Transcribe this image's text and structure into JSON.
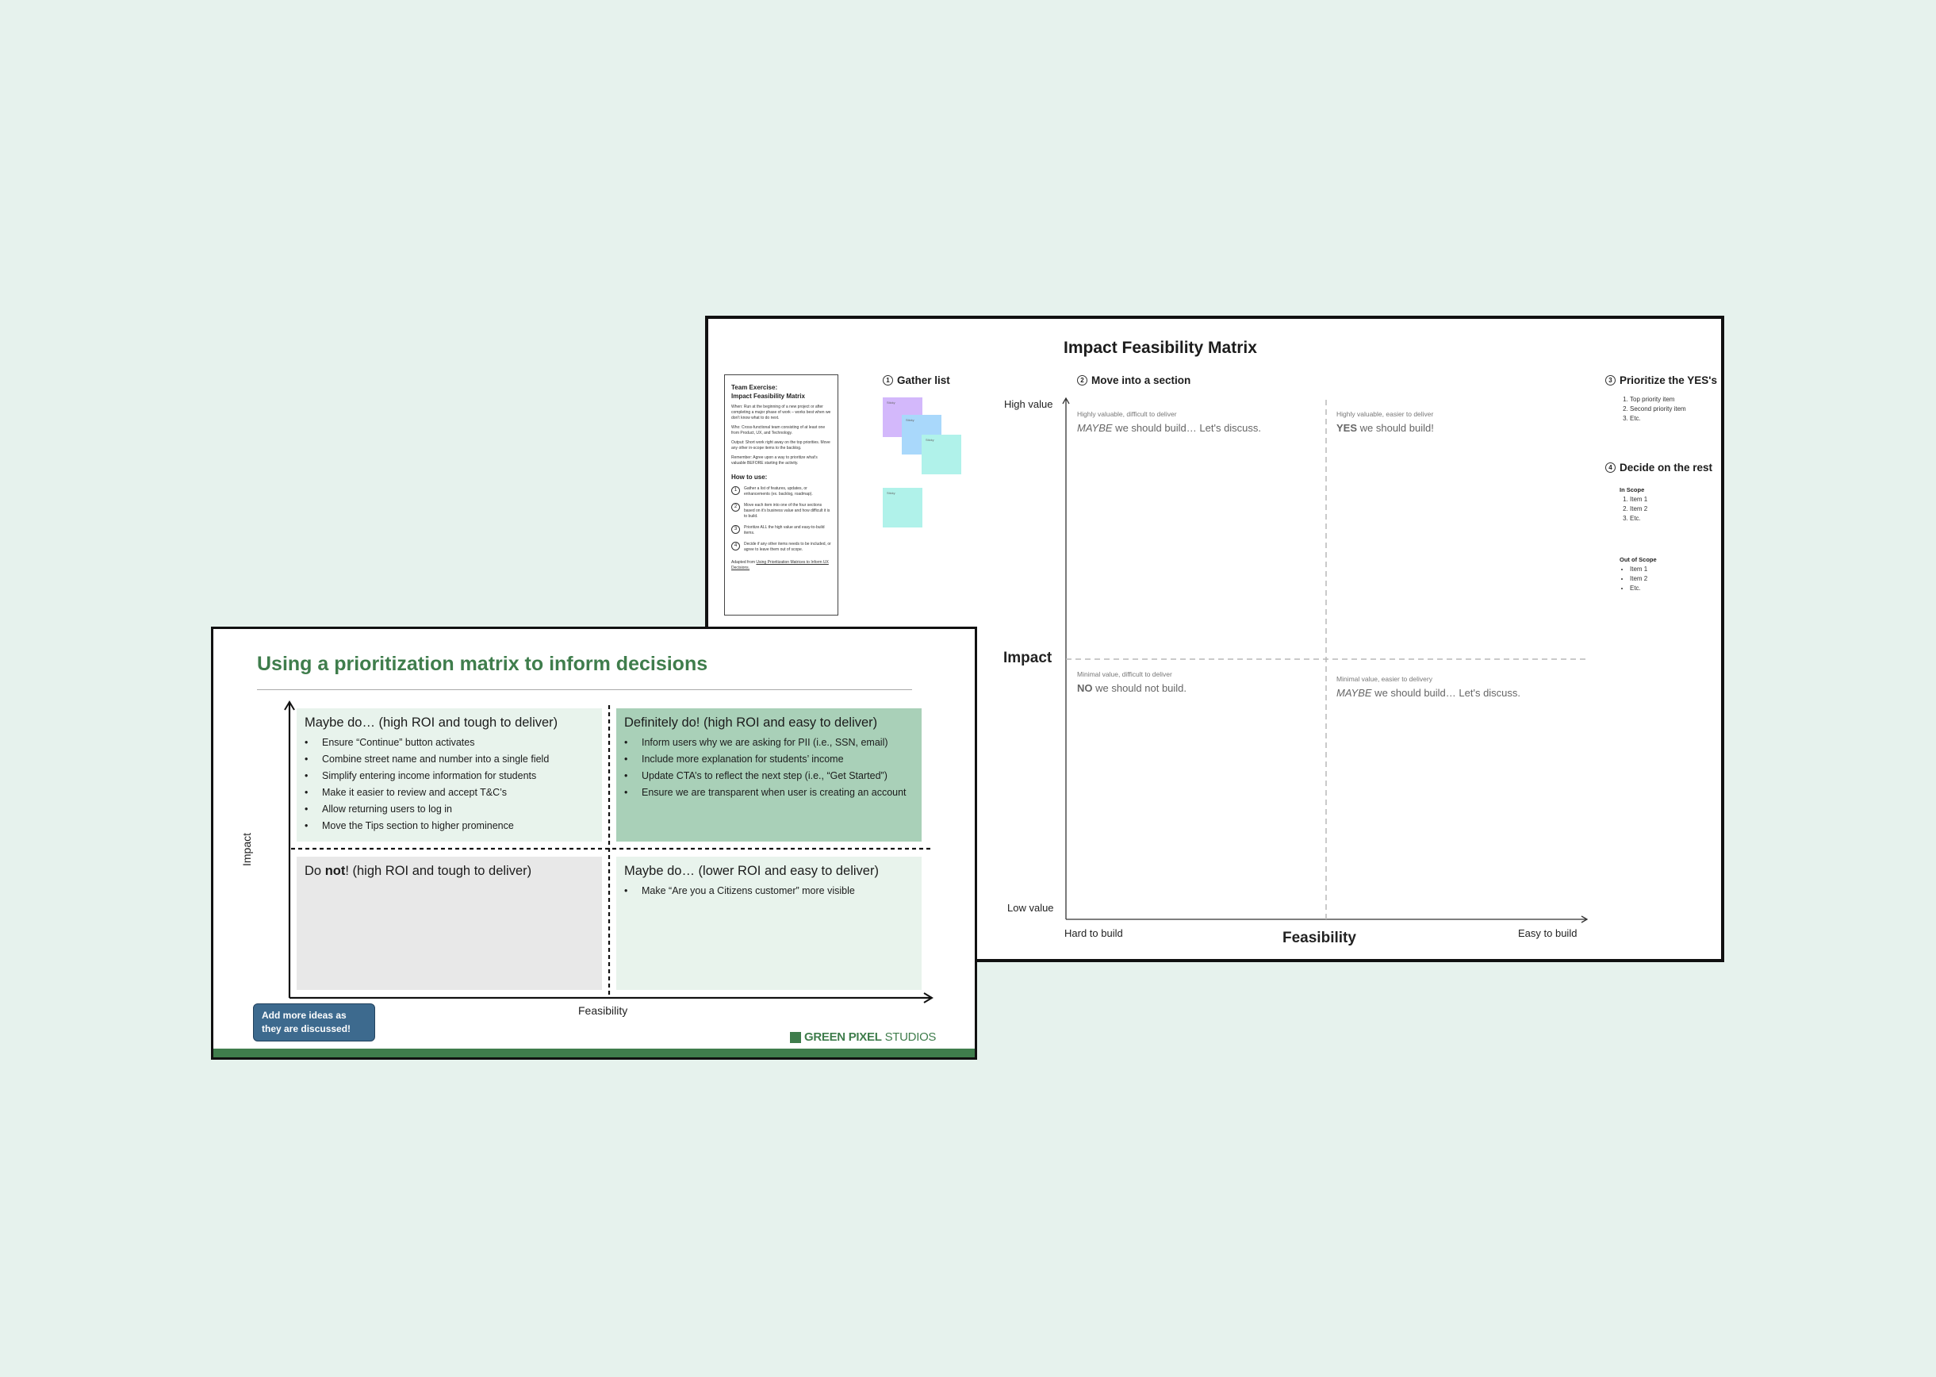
{
  "impact_matrix": {
    "title": "Impact Feasibility Matrix",
    "guide": {
      "title_line1": "Team Exercise:",
      "title_line2": "Impact Feasibility Matrix",
      "when": "When: Run at the beginning of a new project or after completing a major phase of work – works best when we don't know what to do next.",
      "who": "Who: Cross-functional team consisting of at least one from Product, UX, and Technology.",
      "output": "Output: Short work right away on the top priorities. Move any other in-scope items to the backlog.",
      "remember": "Remember: Agree upon a way to prioritize what's valuable BEFORE starting the activity.",
      "how_to": "How to use:",
      "steps": [
        {
          "n": "1",
          "text": "Gather a list of features, updates, or enhancements (ex. backlog, roadmap)."
        },
        {
          "n": "2",
          "text": "Move each item into one of the four sections based on it's business value and how difficult it is to build."
        },
        {
          "n": "3",
          "text": "Prioritize ALL the high value and easy-to-build items."
        },
        {
          "n": "4",
          "text": "Decide if any other items needs to be included, or agree to leave them out of scope."
        }
      ],
      "footer_prefix": "Adapted from ",
      "footer_link": "Using Prioritization Matrices to Inform UX Decisions."
    },
    "steps": {
      "gather": {
        "num": "1",
        "label": "Gather list"
      },
      "move": {
        "num": "2",
        "label": "Move into a section"
      },
      "prioritize": {
        "num": "3",
        "label": "Prioritize the YES's"
      },
      "decide": {
        "num": "4",
        "label": "Decide on the rest"
      }
    },
    "stickies": [
      {
        "color": "#d3b8fb",
        "label": "Sticky"
      },
      {
        "color": "#a9d8fb",
        "label": "Sticky"
      },
      {
        "color": "#b0f2ea",
        "label": "Sticky"
      },
      {
        "color": "#b0f2ea",
        "label": "Sticky"
      }
    ],
    "axes": {
      "high_value": "High value",
      "low_value": "Low value",
      "impact": "Impact",
      "hard_to_build": "Hard to build",
      "easy_to_build": "Easy to build",
      "feasibility": "Feasibility"
    },
    "quadrants": {
      "tl": {
        "small": "Highly valuable, difficult to deliver",
        "emph": "MAYBE",
        "rest": " we should build… Let's discuss."
      },
      "tr": {
        "small": "Highly valuable, easier to deliver",
        "emph": "YES",
        "rest": " we should build!"
      },
      "bl": {
        "small": "Minimal value, difficult to deliver",
        "emph": "NO",
        "rest": " we should not build."
      },
      "br": {
        "small": "Minimal value, easier to delivery",
        "emph": "MAYBE",
        "rest": " we should build… Let's discuss."
      }
    },
    "prioritize_list": [
      "Top priority item",
      "Second priority item",
      "Etc."
    ],
    "in_scope": {
      "title": "In Scope",
      "items": [
        "Item 1",
        "Item 2",
        "Etc."
      ]
    },
    "out_scope": {
      "title": "Out of Scope",
      "items": [
        "Item 1",
        "Item 2",
        "Etc."
      ]
    }
  },
  "prioritization": {
    "title": "Using a prioritization matrix to inform decisions",
    "y_axis": "Impact",
    "x_axis": "Feasibility",
    "tl": {
      "heading": "Maybe do… (high ROI and tough to deliver)",
      "items": [
        "Ensure “Continue” button activates",
        "Combine street name and number into a single field",
        "Simplify entering income information for students",
        "Make it easier to review and accept T&C’s",
        "Allow returning users to log in",
        "Move the Tips section to higher prominence"
      ]
    },
    "tr": {
      "heading": "Definitely do! (high ROI and easy to deliver)",
      "items": [
        "Inform users why we are asking for PII (i.e., SSN, email)",
        "Include more explanation for students’ income",
        "Update CTA’s to reflect the next step (i.e., “Get Started”)",
        "Ensure we are transparent when user is creating an account"
      ]
    },
    "bl": {
      "heading_pre": "Do ",
      "heading_bold": "not",
      "heading_post": "! (high ROI and tough to deliver)"
    },
    "br": {
      "heading": "Maybe do… (lower ROI and easy to deliver)",
      "items": [
        "Make “Are you a Citizens customer” more visible"
      ]
    },
    "note": "Add more ideas as they are discussed!",
    "logo_bold": "GREEN PIXEL",
    "logo_light": " STUDIOS",
    "colors": {
      "brand_green": "#3f7d4c",
      "light_green": "#e8f3ec",
      "mid_green": "#a9d0b8",
      "grey": "#e8e8e8",
      "note_blue": "#3d6a8e"
    }
  }
}
